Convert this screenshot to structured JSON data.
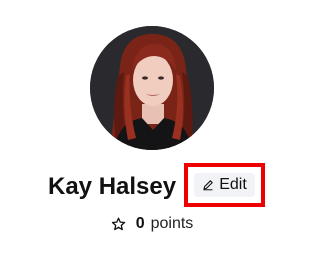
{
  "profile": {
    "name": "Kay Halsey",
    "avatar_alt": "Profile photo of Kay Halsey",
    "edit_label": "Edit",
    "points_count": "0",
    "points_label": "points"
  },
  "icons": {
    "edit": "pencil-icon",
    "points": "star-outline-icon"
  },
  "colors": {
    "highlight": "#ee0000",
    "edit_button_bg": "#f1f3f6",
    "text": "#111111"
  }
}
